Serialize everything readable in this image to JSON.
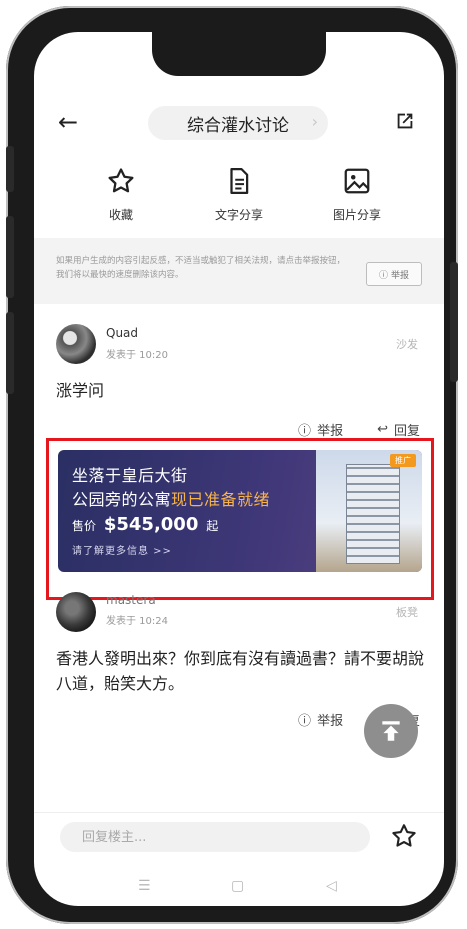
{
  "header": {
    "title": "综合灌水讨论"
  },
  "actions": [
    {
      "label": "收藏"
    },
    {
      "label": "文字分享"
    },
    {
      "label": "图片分享"
    }
  ],
  "notice": {
    "text": "如果用户生成的内容引起反感，不适当或触犯了相关法规，请点击举报按钮，我们将以最快的速度删除该内容。",
    "report_label": "举报"
  },
  "posts": [
    {
      "user": "Quad",
      "time": "发表于 10:20",
      "floor": "沙发",
      "content": "涨学问",
      "report": "举报",
      "reply": "回复"
    },
    {
      "user": "mastera",
      "time": "发表于 10:24",
      "floor": "板凳",
      "content": "香港人發明出來？你到底有沒有讀過書？請不要胡說八道，貽笑大方。",
      "report": "举报",
      "reply": "回复"
    }
  ],
  "ad": {
    "line1": "坐落于皇后大街",
    "line2_prefix": "公园旁的公寓",
    "line2_highlight": "现已准备就绪",
    "price_prefix": "售价",
    "price": "$545,000",
    "price_suffix": "起",
    "cta": "请了解更多信息 >>",
    "tag": "推广",
    "highlight_color": "#f7b34a"
  },
  "bottom": {
    "reply_placeholder": "回复楼主..."
  }
}
